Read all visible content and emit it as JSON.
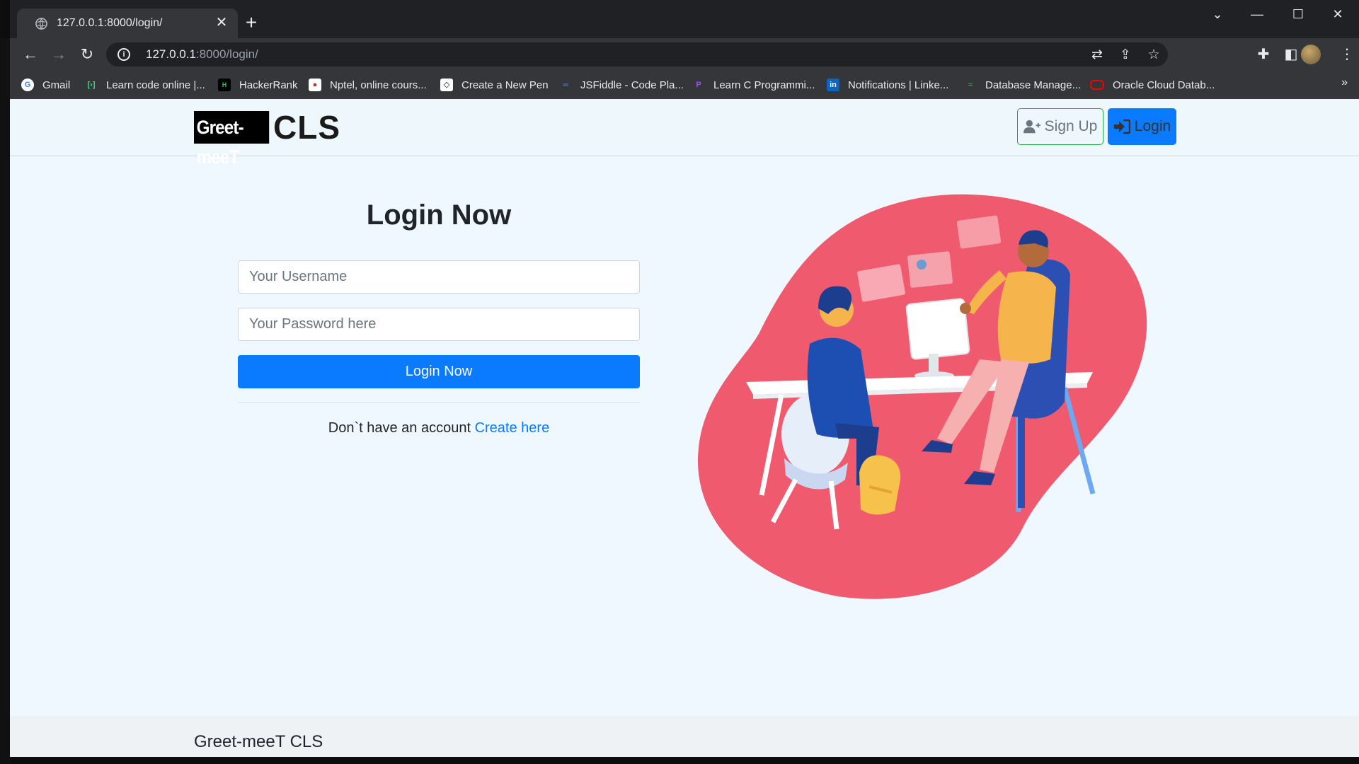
{
  "browser": {
    "tab_title": "127.0.0.1:8000/login/",
    "url_host": "127.0.0.1",
    "url_path": ":8000/login/",
    "bookmarks": [
      {
        "label": "Gmail",
        "icon": "google-icon"
      },
      {
        "label": "Learn code online |...",
        "icon": "code-icon"
      },
      {
        "label": "HackerRank",
        "icon": "hackerrank-icon"
      },
      {
        "label": "Nptel, online cours...",
        "icon": "nptel-icon"
      },
      {
        "label": "Create a New Pen",
        "icon": "codepen-icon"
      },
      {
        "label": "JSFiddle - Code Pla...",
        "icon": "jsfiddle-icon"
      },
      {
        "label": "Learn C Programmi...",
        "icon": "programiz-icon"
      },
      {
        "label": "Notifications | Linke...",
        "icon": "linkedin-icon"
      },
      {
        "label": "Database Manage...",
        "icon": "database-icon"
      },
      {
        "label": "Oracle Cloud Datab...",
        "icon": "oracle-icon"
      }
    ]
  },
  "navbar": {
    "logo_box": "Greet-meeT",
    "logo_suffix": "CLS",
    "signup_label": "Sign Up",
    "login_label": "Login"
  },
  "login": {
    "heading": "Login Now",
    "username_placeholder": "Your Username",
    "password_placeholder": "Your Password here",
    "submit_label": "Login Now",
    "no_account_text": "Don`t have an account ",
    "create_link": "Create here"
  },
  "footer": {
    "brand": "Greet-meeT CLS"
  },
  "colors": {
    "primary": "#0a7bff",
    "success_border": "#28a745",
    "page_bg": "#eef8fe",
    "illustration_blob": "#f05a6e"
  }
}
